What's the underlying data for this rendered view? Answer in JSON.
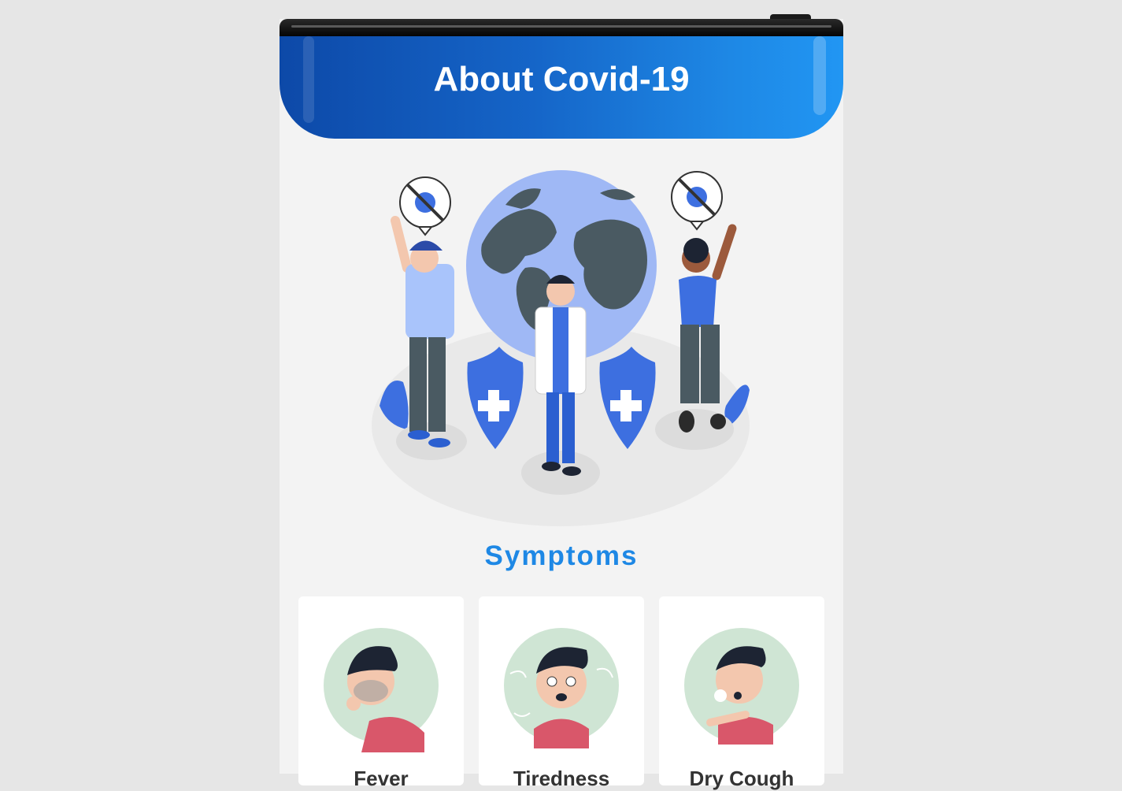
{
  "header": {
    "title": "About Covid-19"
  },
  "hero": {
    "illustration": "doctor-and-people-with-globe-and-shields"
  },
  "symptoms": {
    "title": "Symptoms",
    "cards": [
      {
        "label": "Fever",
        "illustration": "fever-person"
      },
      {
        "label": "Tiredness",
        "illustration": "tired-person"
      },
      {
        "label": "Dry Cough",
        "illustration": "coughing-person"
      }
    ]
  },
  "colors": {
    "header_start": "#0d49a8",
    "header_end": "#2196f3",
    "accent": "#1e88e5",
    "card_circle": "#cfe5d4"
  }
}
